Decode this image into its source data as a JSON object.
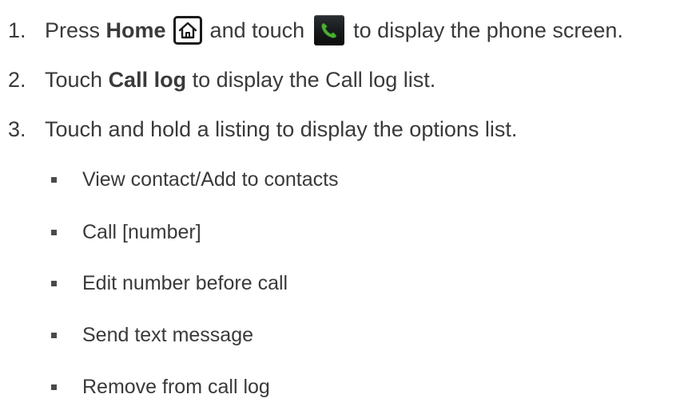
{
  "steps": [
    {
      "number": "1.",
      "pre": "Press ",
      "bold": "Home",
      "mid": "and touch",
      "post": "to display the phone screen.",
      "home_icon": "home-key-icon",
      "phone_icon": "phone-app-icon"
    },
    {
      "number": "2.",
      "pre": "Touch ",
      "bold": "Call log",
      "post": " to display the Call log list."
    },
    {
      "number": "3.",
      "text": "Touch and hold a listing to display the options list."
    }
  ],
  "options": [
    "View contact/Add to contacts",
    "Call [number]",
    "Edit number before call",
    "Send text message",
    "Remove from call log"
  ],
  "colors": {
    "text": "#3a3a3a",
    "phone_green": "#4caf32",
    "bullet": "#4a4a4a"
  }
}
